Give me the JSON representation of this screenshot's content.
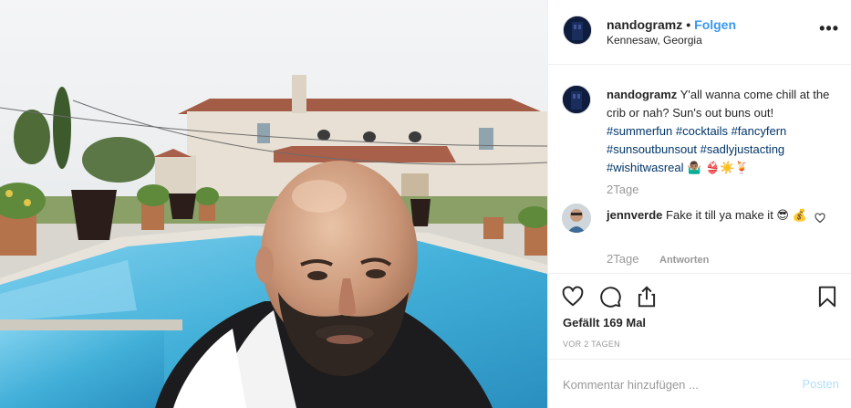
{
  "post": {
    "username": "nandogramz",
    "separator": "•",
    "follow_label": "Folgen",
    "location": "Kennesaw, Georgia",
    "more_icon": "more-horizontal-icon"
  },
  "caption": {
    "username": "nandogramz",
    "text": "Y'all wanna come chill at the crib or nah? Sun's out buns out!",
    "hashtags": [
      "#summerfun",
      "#cocktails",
      "#fancyfern",
      "#sunsoutbunsout",
      "#sadlyjustacting",
      "#wishitwasreal"
    ],
    "emoji_tail": "🤷🏽‍♂️ 👙☀️🍹",
    "time": "2Tage"
  },
  "comment": {
    "username": "jennverde",
    "text": "Fake it till ya make it 😎 💰",
    "time": "2Tage",
    "reply_label": "Antworten"
  },
  "actions": {
    "likes_text": "Gefällt 169 Mal",
    "date_text": "VOR 2 TAGEN"
  },
  "add_comment": {
    "placeholder": "Kommentar hinzufügen ...",
    "post_label": "Posten"
  },
  "colors": {
    "link_blue": "#3897f0",
    "hashtag": "#003569",
    "muted": "#999999",
    "post_disabled": "#b2dffc"
  }
}
